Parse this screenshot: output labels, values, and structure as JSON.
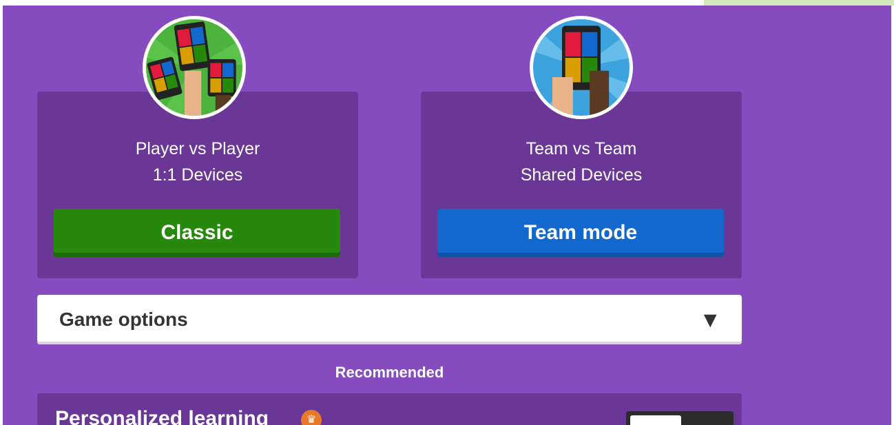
{
  "modes": {
    "classic": {
      "line1": "Player vs Player",
      "line2": "1:1 Devices",
      "button_label": "Classic"
    },
    "team": {
      "line1": "Team vs Team",
      "line2": "Shared Devices",
      "button_label": "Team mode"
    }
  },
  "game_options": {
    "label": "Game options",
    "caret": "▼"
  },
  "section_heading": "Recommended",
  "personalized_learning": {
    "label": "Personalized learning",
    "badge_icon": "crown-icon",
    "toggle_on": false
  },
  "colors": {
    "background": "#864cbf",
    "card": "#6a3797",
    "classic_button": "#26890c",
    "team_button": "#1368ce",
    "badge": "#e8792b"
  }
}
